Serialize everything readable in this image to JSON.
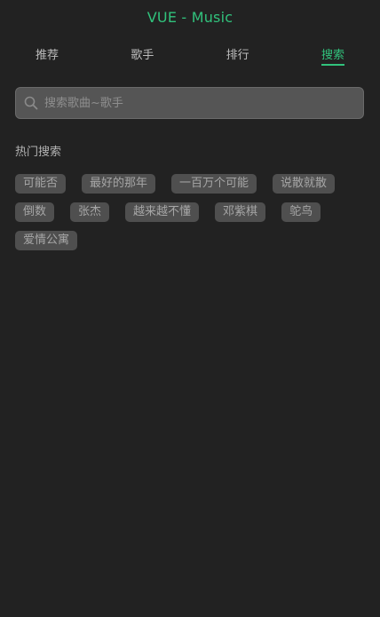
{
  "header": {
    "title": "VUE - Music"
  },
  "tabs": [
    {
      "label": "推荐",
      "active": false
    },
    {
      "label": "歌手",
      "active": false
    },
    {
      "label": "排行",
      "active": false
    },
    {
      "label": "搜索",
      "active": true
    }
  ],
  "search": {
    "placeholder": "搜索歌曲~歌手",
    "value": "",
    "icon": "search-icon"
  },
  "hot": {
    "title": "热门搜索",
    "items": [
      "可能否",
      "最好的那年",
      "一百万个可能",
      "说散就散",
      "倒数",
      "张杰",
      "越来越不懂",
      "邓紫棋",
      "鸵鸟",
      "爱情公寓"
    ]
  },
  "colors": {
    "accent": "#31c27c",
    "background": "#222222"
  }
}
